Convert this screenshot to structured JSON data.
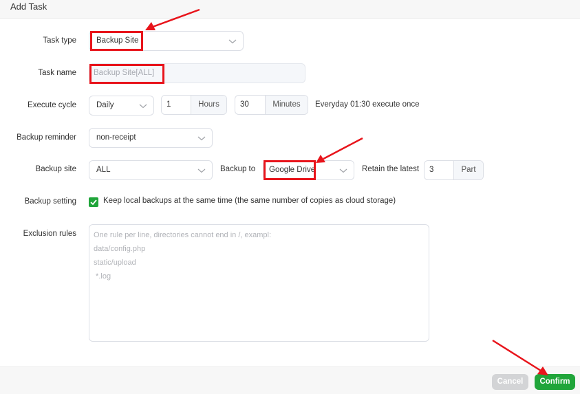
{
  "dialog": {
    "title": "Add Task"
  },
  "form": {
    "task_type": {
      "label": "Task type",
      "value": "Backup Site"
    },
    "task_name": {
      "label": "Task name",
      "value": "Backup Site[ALL]"
    },
    "execute_cycle": {
      "label": "Execute cycle",
      "cycle": "Daily",
      "hours_value": "1",
      "hours_unit": "Hours",
      "minutes_value": "30",
      "minutes_unit": "Minutes",
      "summary": "Everyday 01:30 execute once"
    },
    "backup_reminder": {
      "label": "Backup reminder",
      "value": "non-receipt"
    },
    "backup_site": {
      "label": "Backup site",
      "value": "ALL",
      "backup_to_label": "Backup to",
      "backup_to_value": "Google Drive",
      "retain_label": "Retain the latest",
      "retain_value": "3",
      "retain_unit": "Part"
    },
    "backup_setting": {
      "label": "Backup setting",
      "checkbox_label": "Keep local backups at the same time (the same number of copies as cloud storage)",
      "checked": true
    },
    "exclusion_rules": {
      "label": "Exclusion rules",
      "placeholder_lines": [
        "One rule per line, directories cannot end in /, exampl:",
        "data/config.php",
        "static/upload",
        " *.log"
      ]
    }
  },
  "footer": {
    "cancel_label": "Cancel",
    "confirm_label": "Confirm"
  },
  "annotations": {
    "color": "#e8141b"
  },
  "colors": {
    "accent": "#20a53a",
    "disabled_button": "#d3d4d6"
  }
}
